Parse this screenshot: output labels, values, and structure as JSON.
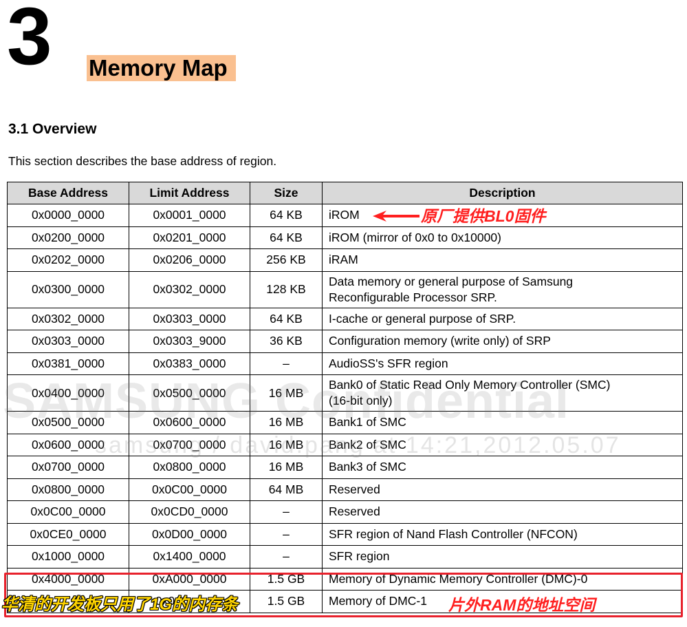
{
  "chapter": {
    "number": "3",
    "title": "Memory Map"
  },
  "section": {
    "heading": "3.1 Overview",
    "intro": "This section describes the base address of region."
  },
  "table": {
    "headers": [
      "Base Address",
      "Limit Address",
      "Size",
      "Description"
    ],
    "rows": [
      {
        "base": "0x0000_0000",
        "limit": "0x0001_0000",
        "size": "64 KB",
        "desc": "iROM",
        "desc2": ""
      },
      {
        "base": "0x0200_0000",
        "limit": "0x0201_0000",
        "size": "64 KB",
        "desc": "iROM (mirror of 0x0 to 0x10000)",
        "desc2": ""
      },
      {
        "base": "0x0202_0000",
        "limit": "0x0206_0000",
        "size": "256 KB",
        "desc": "iRAM",
        "desc2": ""
      },
      {
        "base": "0x0300_0000",
        "limit": "0x0302_0000",
        "size": "128 KB",
        "desc": "Data memory or general purpose of Samsung",
        "desc2": "Reconfigurable Processor SRP."
      },
      {
        "base": "0x0302_0000",
        "limit": "0x0303_0000",
        "size": "64 KB",
        "desc": "I-cache or general purpose of SRP.",
        "desc2": ""
      },
      {
        "base": "0x0303_0000",
        "limit": "0x0303_9000",
        "size": "36 KB",
        "desc": "Configuration memory (write only) of SRP",
        "desc2": ""
      },
      {
        "base": "0x0381_0000",
        "limit": "0x0383_0000",
        "size": "–",
        "desc": "AudioSS's SFR region",
        "desc2": ""
      },
      {
        "base": "0x0400_0000",
        "limit": "0x0500_0000",
        "size": "16 MB",
        "desc": "Bank0 of Static Read Only Memory Controller (SMC)",
        "desc2": "(16-bit only)"
      },
      {
        "base": "0x0500_0000",
        "limit": "0x0600_0000",
        "size": "16 MB",
        "desc": "Bank1 of SMC",
        "desc2": ""
      },
      {
        "base": "0x0600_0000",
        "limit": "0x0700_0000",
        "size": "16 MB",
        "desc": "Bank2 of SMC",
        "desc2": ""
      },
      {
        "base": "0x0700_0000",
        "limit": "0x0800_0000",
        "size": "16 MB",
        "desc": "Bank3 of SMC",
        "desc2": ""
      },
      {
        "base": "0x0800_0000",
        "limit": "0x0C00_0000",
        "size": "64 MB",
        "desc": "Reserved",
        "desc2": ""
      },
      {
        "base": "0x0C00_0000",
        "limit": "0x0CD0_0000",
        "size": "–",
        "desc": "Reserved",
        "desc2": ""
      },
      {
        "base": "0x0CE0_0000",
        "limit": "0x0D00_0000",
        "size": "–",
        "desc": "SFR region of Nand Flash Controller (NFCON)",
        "desc2": ""
      },
      {
        "base": "0x1000_0000",
        "limit": "0x1400_0000",
        "size": "–",
        "desc": "SFR region",
        "desc2": ""
      },
      {
        "base": "0x4000_0000",
        "limit": "0xA000_0000",
        "size": "1.5 GB",
        "desc": "Memory of Dynamic Memory Controller (DMC)-0",
        "desc2": ""
      },
      {
        "base": "",
        "limit": "0x0",
        "size": "1.5 GB",
        "desc": "Memory of DMC-1",
        "desc2": ""
      }
    ]
  },
  "watermark": {
    "line1": "SAMSUNG Confidential",
    "line2": "samsung / david.pang at 14:21,2012.05.07"
  },
  "annotations": {
    "irom_note": "原厂提供BL0固件",
    "ram_note": "片外RAM的地址空间",
    "board_note": "华清的开发板只用了1G的内存条",
    "color_red": "#ff1f1f",
    "color_yellow": "#ffd400",
    "highlight_color": "#e8212c"
  }
}
